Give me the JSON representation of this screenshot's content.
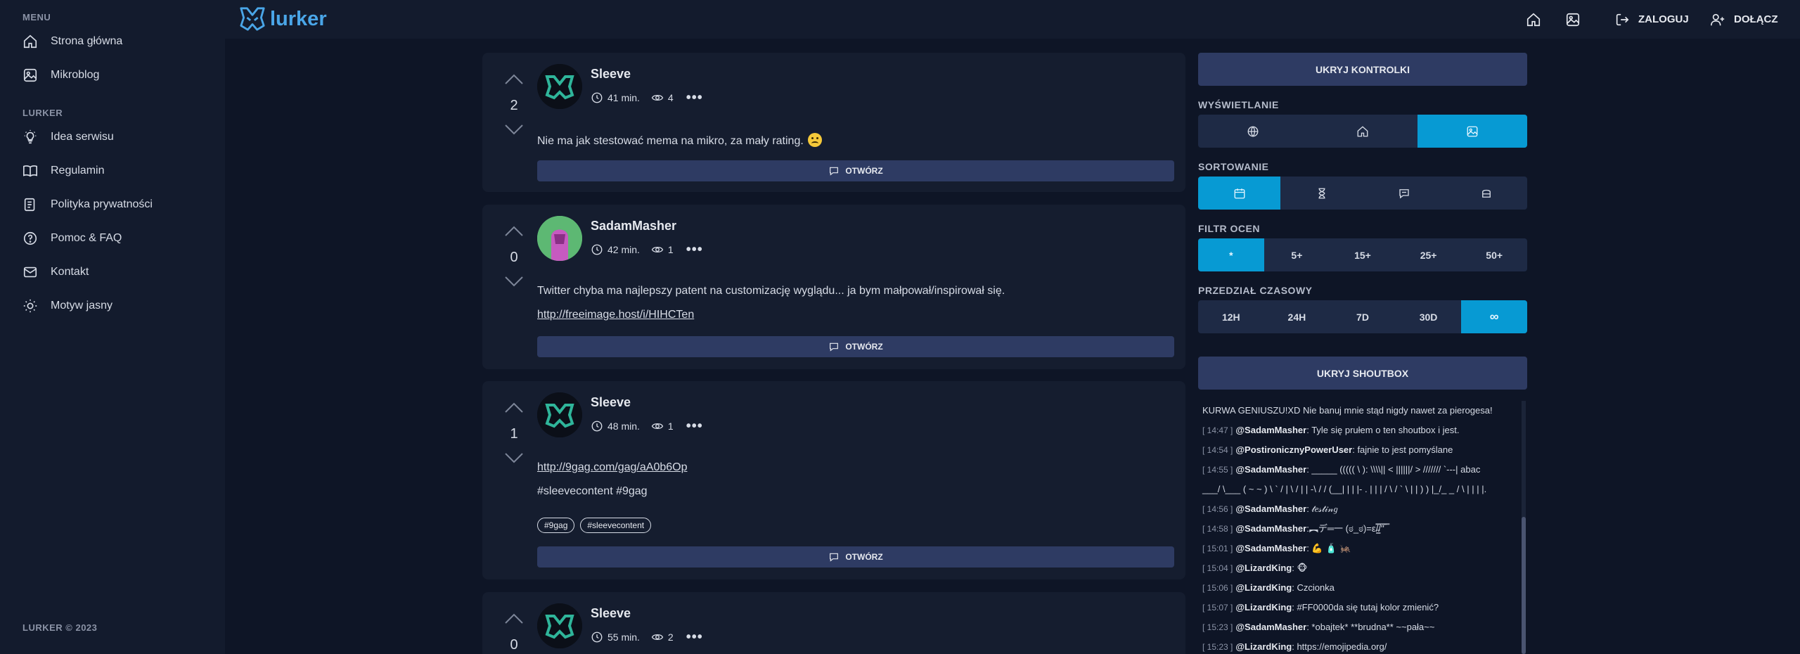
{
  "sidebar": {
    "menu_title": "MENU",
    "items_menu": [
      {
        "label": "Strona główna",
        "icon": "home-icon"
      },
      {
        "label": "Mikroblog",
        "icon": "image-icon"
      }
    ],
    "lurker_title": "LURKER",
    "items_lurker": [
      {
        "label": "Idea serwisu",
        "icon": "lightbulb-icon"
      },
      {
        "label": "Regulamin",
        "icon": "book-icon"
      },
      {
        "label": "Polityka prywatności",
        "icon": "document-icon"
      },
      {
        "label": "Pomoc & FAQ",
        "icon": "help-icon"
      },
      {
        "label": "Kontakt",
        "icon": "mail-icon"
      },
      {
        "label": "Motyw jasny",
        "icon": "sun-icon"
      }
    ],
    "footer": "LURKER © 2023"
  },
  "topbar": {
    "logo_text": "lurker",
    "login_label": "ZALOGUJ",
    "join_label": "DOŁĄCZ"
  },
  "posts": [
    {
      "score": "2",
      "author": "Sleeve",
      "time": "41 min.",
      "views": "4",
      "text": "Nie ma jak stestować mema na mikro, za mały rating.",
      "open_label": "OTWÓRZ"
    },
    {
      "score": "0",
      "author": "SadamMasher",
      "time": "42 min.",
      "views": "1",
      "text": "Twitter chyba ma najlepszy patent na customizację wyglądu... ja bym małpował/inspirował się.",
      "link": "http://freeimage.host/i/HIHCTen",
      "open_label": "OTWÓRZ"
    },
    {
      "score": "1",
      "author": "Sleeve",
      "time": "48 min.",
      "views": "1",
      "link": "http://9gag.com/gag/aA0b6Op",
      "hashtags_text": "#sleevecontent #9gag",
      "tags": [
        "#9gag",
        "#sleevecontent"
      ],
      "open_label": "OTWÓRZ"
    },
    {
      "score": "0",
      "author": "Sleeve",
      "time": "55 min.",
      "views": "2"
    }
  ],
  "panel": {
    "hide_controls": "UKRYJ KONTROLKI",
    "display_title": "WYŚWIETLANIE",
    "sort_title": "SORTOWANIE",
    "filter_title": "FILTR OCEN",
    "filter_options": [
      "*",
      "5+",
      "15+",
      "25+",
      "50+"
    ],
    "time_title": "PRZEDZIAŁ CZASOWY",
    "time_options": [
      "12H",
      "24H",
      "7D",
      "30D",
      "∞"
    ],
    "hide_shoutbox": "UKRYJ SHOUTBOX"
  },
  "shoutbox": {
    "first_line": "KURWA GENIUSZU!XD Nie banuj mnie stąd nigdy nawet za pierogesa!",
    "messages": [
      {
        "time": "[ 14:47 ]",
        "user": "@SadamMasher",
        "text": ": Tyle się prułem o ten shoutbox i jest."
      },
      {
        "time": "[ 14:54 ]",
        "user": "@PostironicznyPowerUser",
        "text": ": fajnie to jest pomyślane"
      },
      {
        "time": "[ 14:55 ]",
        "user": "@SadamMasher",
        "text": ": _____ ((((( \\ ): \\\\\\\\|| < ||||||/ > /////// `---| abac"
      },
      {
        "time": "",
        "user": "",
        "text": "___/ \\___ ( ~ ~ ) \\ ` / | \\ / | | -\\ / / (__| | | |- . | | | / \\ / ` \\ | | ) ) |_/_ _ / \\ | | | |."
      },
      {
        "time": "[ 14:56 ]",
        "user": "@SadamMasher",
        "text": ": 𝓉𝑒𝓈𝓉𝒾𝓃𝑔"
      },
      {
        "time": "[ 14:58 ]",
        "user": "@SadamMasher",
        "text": ":︻デ═一 (ಠ_ಠ)=ε/̵͇̿̿/'̿'̿ ̿"
      },
      {
        "time": "[ 15:01 ]",
        "user": "@SadamMasher",
        "text": ": 💪 🧴 🦗"
      },
      {
        "time": "[ 15:04 ]",
        "user": "@LizardKing",
        "text": ": 🐵"
      },
      {
        "time": "[ 15:06 ]",
        "user": "@LizardKing",
        "text": ": Czcionka"
      },
      {
        "time": "[ 15:07 ]",
        "user": "@LizardKing",
        "text": ": #FF0000da się tutaj kolor zmienić?"
      },
      {
        "time": "[ 15:23 ]",
        "user": "@SadamMasher",
        "text": ": *obajtek* **brudna** ~~pała~~"
      },
      {
        "time": "[ 15:23 ]",
        "user": "@LizardKing",
        "text": ": https://emojipedia.org/"
      }
    ]
  }
}
